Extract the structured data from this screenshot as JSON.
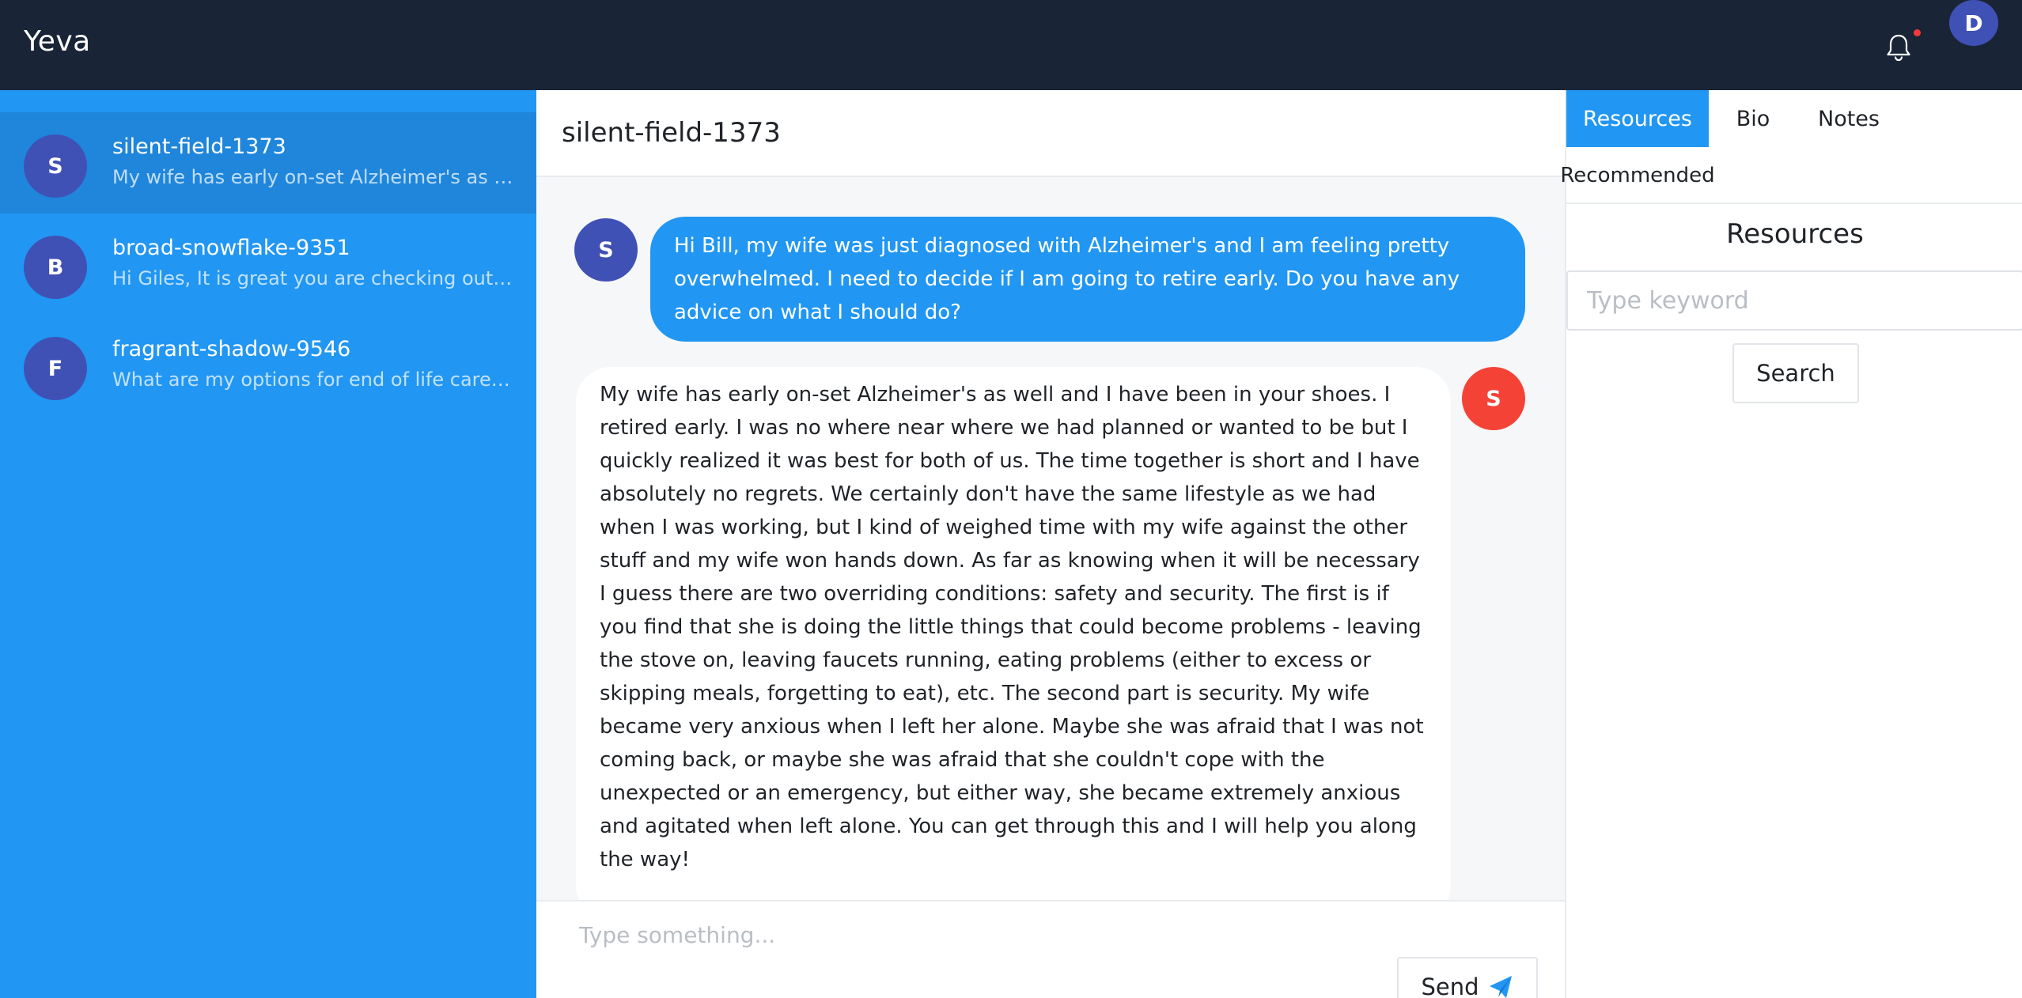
{
  "app": {
    "brand": "Yeva",
    "user_initial": "D"
  },
  "colors": {
    "topbar": "#1a2437",
    "sidebar": "#2196f3",
    "accent": "#2196f3",
    "avatar": "#3f51b5",
    "responder_avatar": "#f44336"
  },
  "conversations": [
    {
      "initial": "S",
      "name": "silent-field-1373",
      "preview": "My wife has early on-set Alzheimer's as well an..."
    },
    {
      "initial": "B",
      "name": "broad-snowflake-9351",
      "preview": "Hi Giles, It is great you are checking out our pl..."
    },
    {
      "initial": "F",
      "name": "fragrant-shadow-9546",
      "preview": "What are my options for end of life care? Addit..."
    }
  ],
  "chat": {
    "title": "silent-field-1373",
    "messages": [
      {
        "initial": "S",
        "text": "Hi Bill, my wife was just diagnosed with Alzheimer's and I am feeling pretty overwhelmed. I need to decide if I am going to retire early. Do you have any advice on what I should do?"
      },
      {
        "initial": "S",
        "text": "My wife has early on-set Alzheimer's as well and I have been in your shoes. I retired early. I was no where near where we had planned or wanted to be but I quickly realized it was best for both of us. The time together is short and I have absolutely no regrets. We certainly don't have the same lifestyle as we had when I was working, but I kind of weighed time with my wife against the other stuff and my wife won hands down. As far as knowing when it will be necessary I guess there are two overriding conditions: safety and security. The first is if you find that she is doing the little things that could become problems - leaving the stove on, leaving faucets running, eating problems (either to excess or skipping meals, forgetting to eat), etc. The second part is security. My wife became very anxious when I left her alone. Maybe she was afraid that I was not coming back, or maybe she was afraid that she couldn't cope with the unexpected or an emergency, but either way, she became extremely anxious and agitated when left alone. You can get through this and I will help you along the way!"
      }
    ],
    "composer": {
      "placeholder": "Type something...",
      "send_label": "Send"
    }
  },
  "right_panel": {
    "tabs": [
      "Resources",
      "Bio",
      "Notes"
    ],
    "subtab": "Recommended",
    "title": "Resources",
    "search_placeholder": "Type keyword",
    "search_label": "Search"
  },
  "icons": {
    "notifications": "bell-icon",
    "send": "paper-plane-icon"
  }
}
